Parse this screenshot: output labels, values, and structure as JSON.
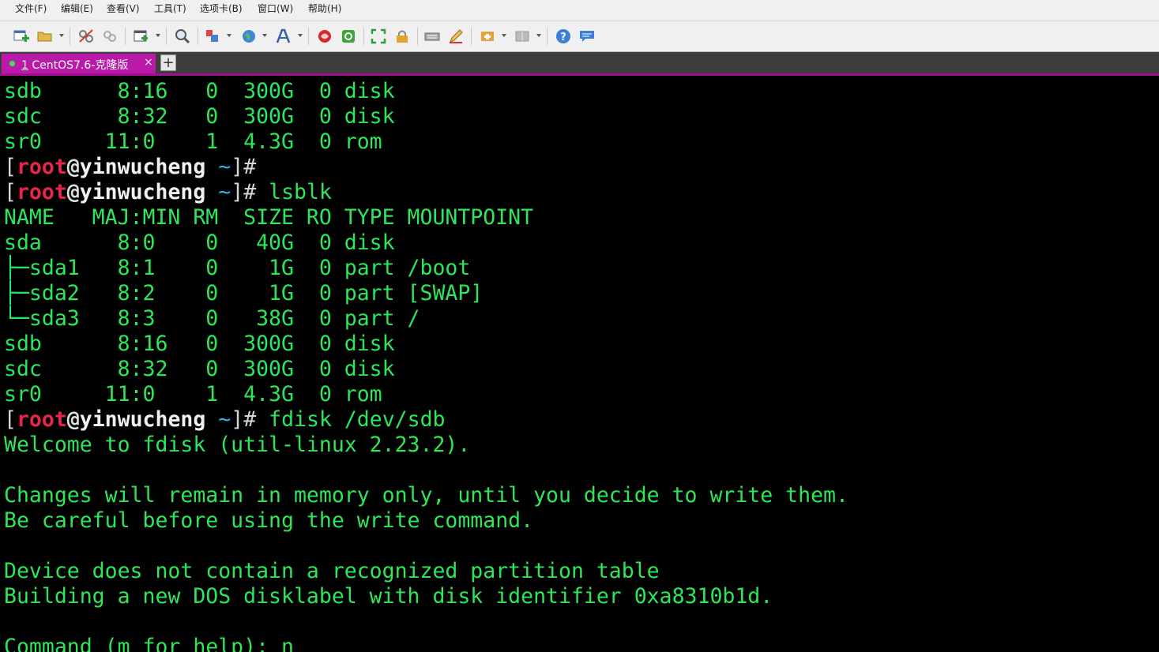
{
  "menu": {
    "items": [
      "文件(F)",
      "编辑(E)",
      "查看(V)",
      "工具(T)",
      "选项卡(B)",
      "窗口(W)",
      "帮助(H)"
    ]
  },
  "toolbar": {
    "icons": [
      "new-session-icon",
      "open-folder-icon",
      "disconnect-icon",
      "reconnect-icon",
      "new-window-icon",
      "find-icon",
      "transfer-icon",
      "globe-icon",
      "font-icon",
      "xftp-icon",
      "xshell-green-icon",
      "fullscreen-icon",
      "lock-icon",
      "keyboard-icon",
      "pen-icon",
      "compose-icon",
      "layout-icon",
      "help-icon",
      "chat-icon"
    ]
  },
  "tab": {
    "number": "1",
    "title": " CentOS7.6-克隆版",
    "close": "×",
    "add": "+"
  },
  "prompt": {
    "open": "[",
    "user": "root",
    "at": "@",
    "host": "yinwucheng",
    "tilde": "~",
    "close": "]# "
  },
  "terminal": {
    "lines": [
      {
        "type": "text",
        "text": "sdb      8:16   0  300G  0 disk"
      },
      {
        "type": "text",
        "text": "sdc      8:32   0  300G  0 disk"
      },
      {
        "type": "text",
        "text": "sr0     11:0    1  4.3G  0 rom"
      },
      {
        "type": "prompt",
        "text": ""
      },
      {
        "type": "prompt",
        "text": "lsblk"
      },
      {
        "type": "text",
        "text": "NAME   MAJ:MIN RM  SIZE RO TYPE MOUNTPOINT"
      },
      {
        "type": "text",
        "text": "sda      8:0    0   40G  0 disk"
      },
      {
        "type": "text",
        "text": "├─sda1   8:1    0    1G  0 part /boot"
      },
      {
        "type": "text",
        "text": "├─sda2   8:2    0    1G  0 part [SWAP]"
      },
      {
        "type": "text",
        "text": "└─sda3   8:3    0   38G  0 part /"
      },
      {
        "type": "text",
        "text": "sdb      8:16   0  300G  0 disk"
      },
      {
        "type": "text",
        "text": "sdc      8:32   0  300G  0 disk"
      },
      {
        "type": "text",
        "text": "sr0     11:0    1  4.3G  0 rom"
      },
      {
        "type": "prompt",
        "text": "fdisk /dev/sdb"
      },
      {
        "type": "text",
        "text": "Welcome to fdisk (util-linux 2.23.2)."
      },
      {
        "type": "text",
        "text": ""
      },
      {
        "type": "text",
        "text": "Changes will remain in memory only, until you decide to write them."
      },
      {
        "type": "text",
        "text": "Be careful before using the write command."
      },
      {
        "type": "text",
        "text": ""
      },
      {
        "type": "text",
        "text": "Device does not contain a recognized partition table"
      },
      {
        "type": "text",
        "text": "Building a new DOS disklabel with disk identifier 0xa8310b1d."
      },
      {
        "type": "text",
        "text": ""
      },
      {
        "type": "text",
        "text": "Command (m for help): n"
      }
    ]
  }
}
